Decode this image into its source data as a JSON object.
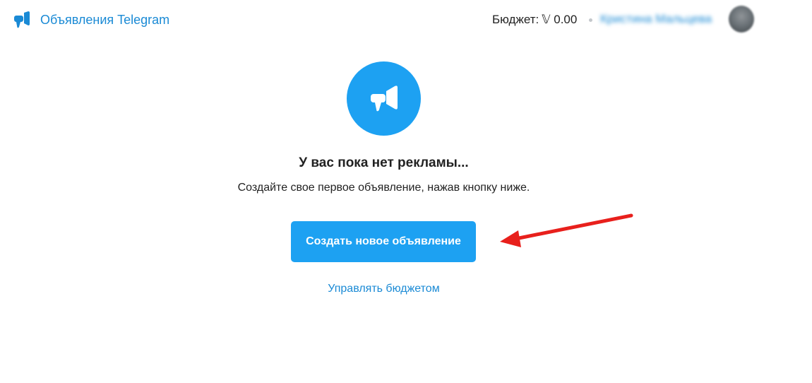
{
  "header": {
    "logo_text": "Объявления Telegram",
    "budget_label": "Бюджет:",
    "budget_amount": "𝕍 0.00",
    "account_name": "Кристина Мальцева",
    "avatar_icon": "user-avatar"
  },
  "empty_state": {
    "icon": "megaphone-icon",
    "title": "У вас пока нет рекламы...",
    "subtitle": "Создайте свое первое объявление, нажав кнопку ниже.",
    "create_button_label": "Создать новое объявление",
    "manage_budget_label": "Управлять бюджетом"
  },
  "colors": {
    "accent": "#1da1f2",
    "link": "#1a8ad5",
    "annotation_arrow": "#e8201c"
  }
}
